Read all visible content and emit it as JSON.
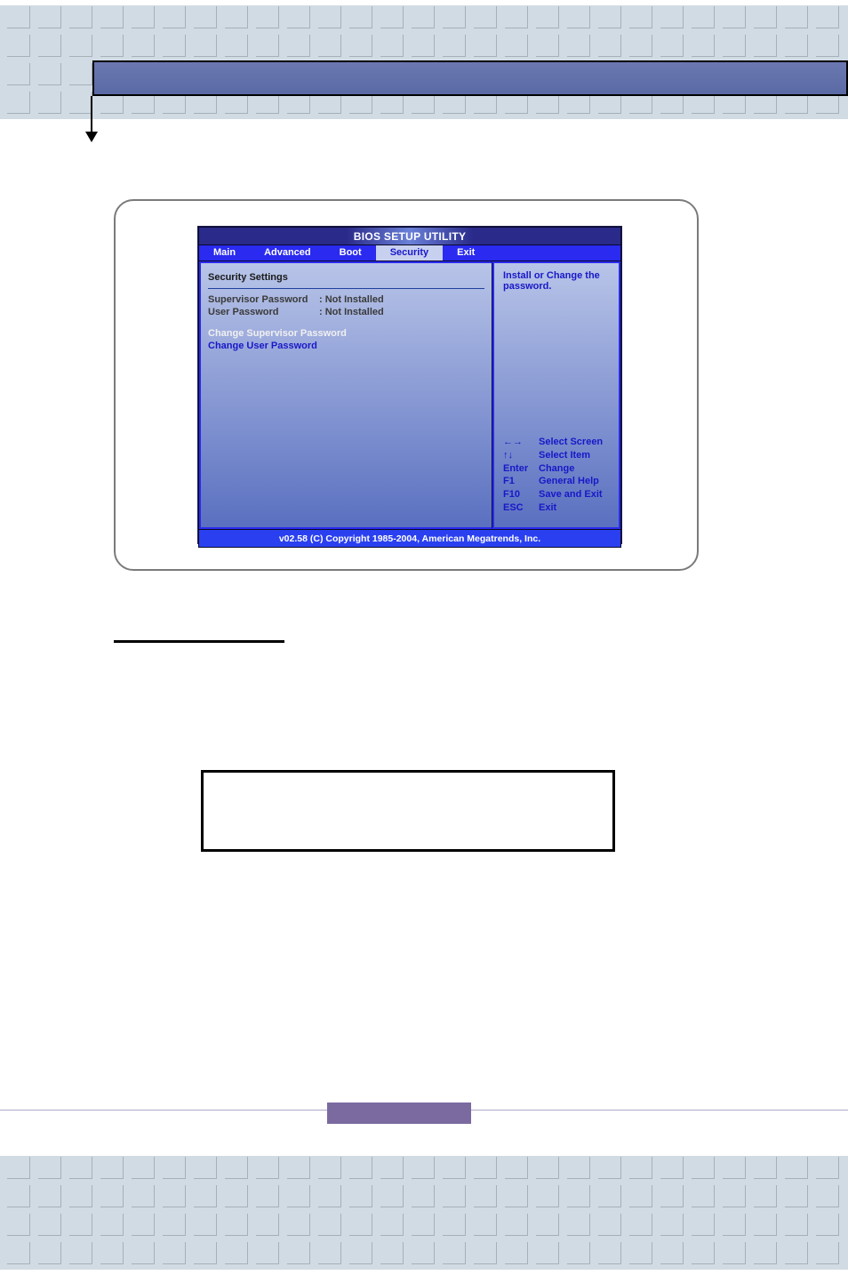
{
  "bios": {
    "title": "BIOS SETUP UTILITY",
    "tabs": [
      "Main",
      "Advanced",
      "Boot",
      "Security",
      "Exit"
    ],
    "active_tab": "Security",
    "panel_heading": "Security Settings",
    "status": [
      {
        "label": "Supervisor Password",
        "value": ": Not Installed"
      },
      {
        "label": "User Password",
        "value": ": Not Installed"
      }
    ],
    "highlighted_option": "Change Supervisor Password",
    "option2": "Change User Password",
    "help_text1": "Install or Change the",
    "help_text2": "password.",
    "hints": [
      {
        "key": "←→",
        "action": "Select Screen"
      },
      {
        "key": "↑↓",
        "action": "Select Item"
      },
      {
        "key": "Enter",
        "action": "Change"
      },
      {
        "key": "F1",
        "action": "General Help"
      },
      {
        "key": "F10",
        "action": "Save and Exit"
      },
      {
        "key": "ESC",
        "action": "Exit"
      }
    ],
    "footer": "v02.58 (C) Copyright  1985-2004, American Megatrends, Inc."
  }
}
